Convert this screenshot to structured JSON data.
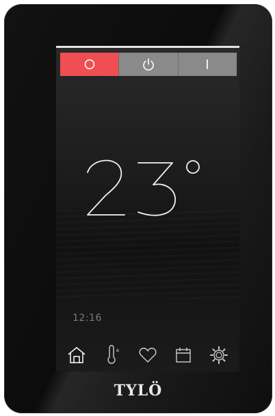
{
  "mode_buttons": [
    {
      "id": "eco",
      "glyph": "O",
      "active": true,
      "color": "#ef4f52"
    },
    {
      "id": "power",
      "glyph": "power-icon",
      "active": false,
      "color": "#8a8a8a"
    },
    {
      "id": "on",
      "glyph": "I",
      "active": false,
      "color": "#8a8a8a"
    }
  ],
  "temperature": {
    "value": "23",
    "unit": "°",
    "display": "23°"
  },
  "clock": "12:16",
  "nav": [
    {
      "id": "home",
      "icon": "home-icon"
    },
    {
      "id": "temperature",
      "icon": "thermometer-icon"
    },
    {
      "id": "favorites",
      "icon": "heart-icon"
    },
    {
      "id": "schedule",
      "icon": "calendar-icon"
    },
    {
      "id": "settings",
      "icon": "gear-icon"
    }
  ],
  "brand": "TYLÖ"
}
